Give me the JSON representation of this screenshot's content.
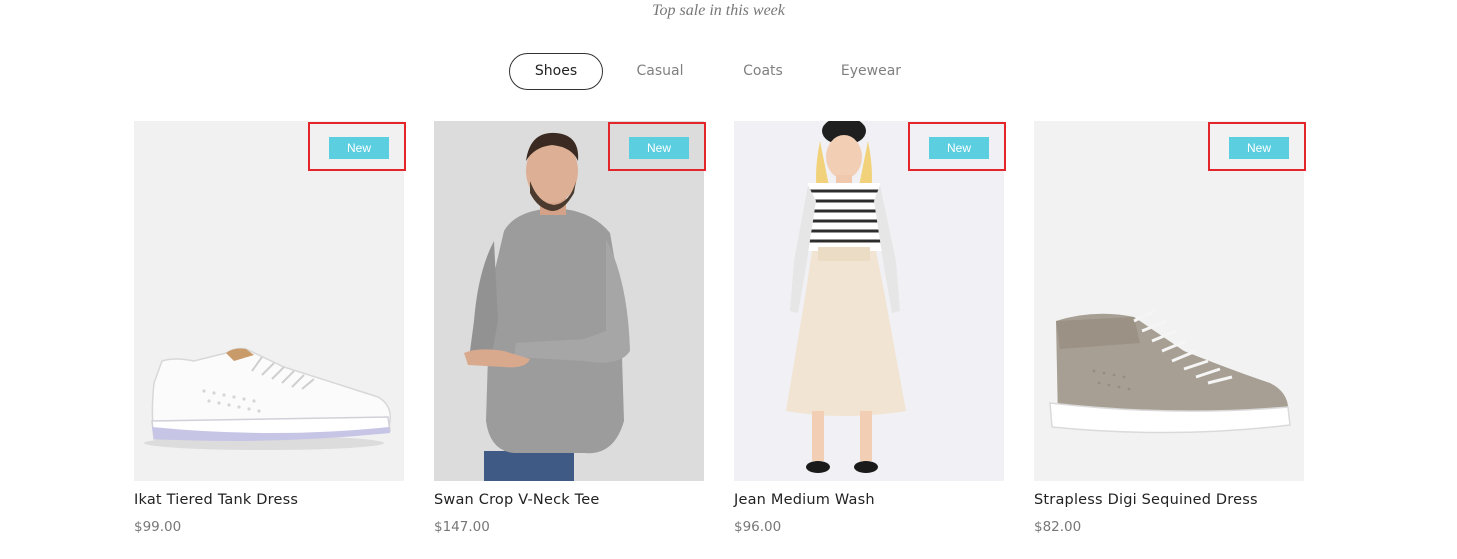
{
  "section": {
    "subtitle": "Top sale in this week"
  },
  "tabs": [
    {
      "label": "Shoes",
      "active": true
    },
    {
      "label": "Casual",
      "active": false
    },
    {
      "label": "Coats",
      "active": false
    },
    {
      "label": "Eyewear",
      "active": false
    }
  ],
  "products": [
    {
      "name": "Ikat Tiered Tank Dress",
      "price": "$99.00",
      "badge": "New",
      "image": "white-sneaker-image"
    },
    {
      "name": "Swan Crop V-Neck Tee",
      "price": "$147.00",
      "badge": "New",
      "image": "man-grey-longsleeve-image"
    },
    {
      "name": "Jean Medium Wash",
      "price": "$96.00",
      "badge": "New",
      "image": "woman-striped-top-skirt-image"
    },
    {
      "name": "Strapless Digi Sequined Dress",
      "price": "$82.00",
      "badge": "New",
      "image": "taupe-high-top-sneaker-image"
    }
  ],
  "colors": {
    "badge": "#5bcee0",
    "highlight": "#e3262c",
    "price": "#777777",
    "active_tab_border": "#333333"
  }
}
